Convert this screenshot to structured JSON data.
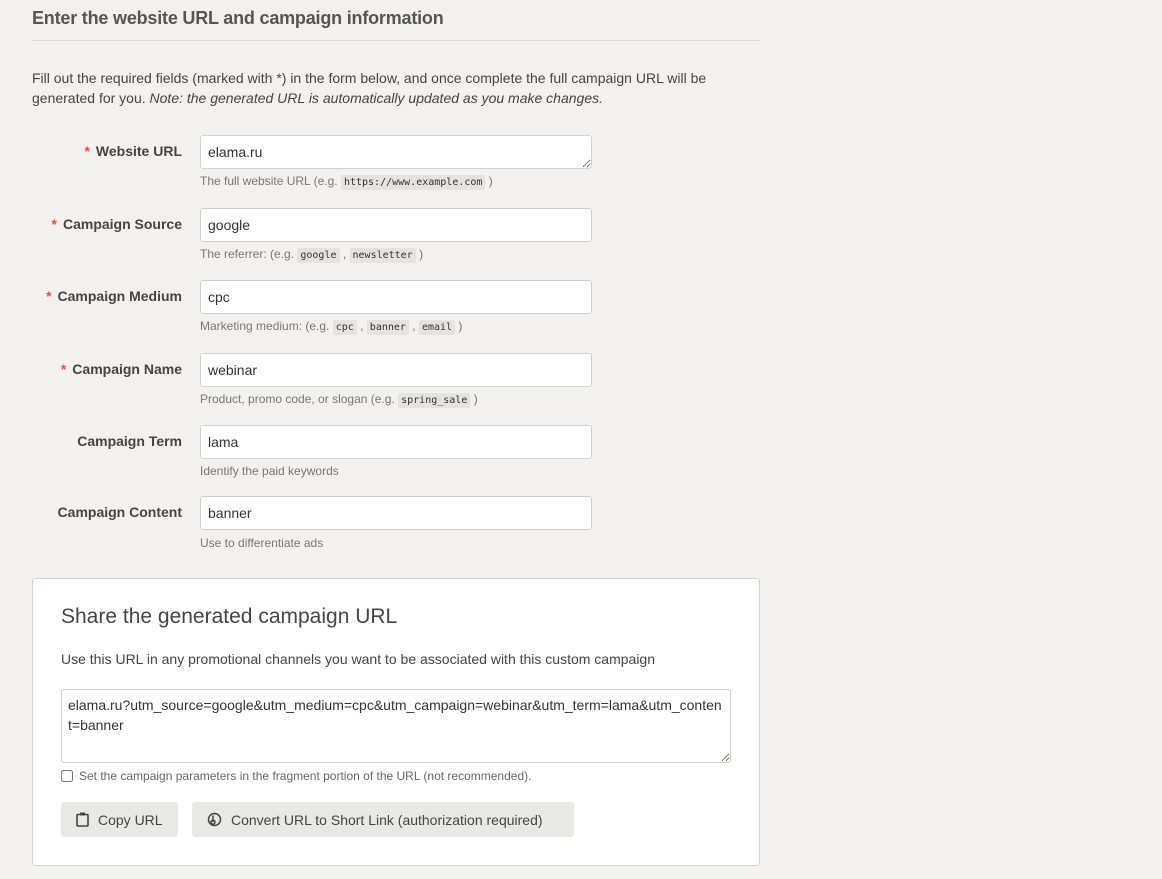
{
  "header": {
    "title": "Enter the website URL and campaign information",
    "intro_text": "Fill out the required fields (marked with *) in the form below, and once complete the full campaign URL will be generated for you. ",
    "intro_note": "Note: the generated URL is automatically updated as you make changes."
  },
  "colors": {
    "background": "#f2f1ef",
    "required_asterisk": "#d9534f",
    "button_bg": "#e8e8e7"
  },
  "form": {
    "required_marker": "*",
    "fields": [
      {
        "label": "Website URL",
        "required": true,
        "value": "elama.ru",
        "help_prefix": "The full website URL (e.g. ",
        "help_codes": [
          "https://www.example.com"
        ],
        "help_suffix": ")"
      },
      {
        "label": "Campaign Source",
        "required": true,
        "value": "google",
        "help_prefix": "The referrer: (e.g. ",
        "help_codes": [
          "google",
          "newsletter"
        ],
        "help_suffix": ")"
      },
      {
        "label": "Campaign Medium",
        "required": true,
        "value": "cpc",
        "help_prefix": "Marketing medium: (e.g. ",
        "help_codes": [
          "cpc",
          "banner",
          "email"
        ],
        "help_suffix": ")"
      },
      {
        "label": "Campaign Name",
        "required": true,
        "value": "webinar",
        "help_prefix": "Product, promo code, or slogan (e.g. ",
        "help_codes": [
          "spring_sale"
        ],
        "help_suffix": ")"
      },
      {
        "label": "Campaign Term",
        "required": false,
        "value": "lama",
        "help_prefix": "Identify the paid keywords"
      },
      {
        "label": "Campaign Content",
        "required": false,
        "value": "banner",
        "help_prefix": "Use to differentiate ads"
      }
    ]
  },
  "share": {
    "title": "Share the generated campaign URL",
    "description": "Use this URL in any promotional channels you want to be associated with this custom campaign",
    "generated_url": "elama.ru?utm_source=google&utm_medium=cpc&utm_campaign=webinar&utm_term=lama&utm_content=banner",
    "fragment_checkbox_label": "Set the campaign parameters in the fragment portion of the URL (not recommended).",
    "fragment_checked": false,
    "copy_button": {
      "label": "Copy URL",
      "icon": "clipboard-icon"
    },
    "short_link_button": {
      "label": "Convert URL to Short Link (authorization required)",
      "icon": "bitly-icon"
    }
  }
}
